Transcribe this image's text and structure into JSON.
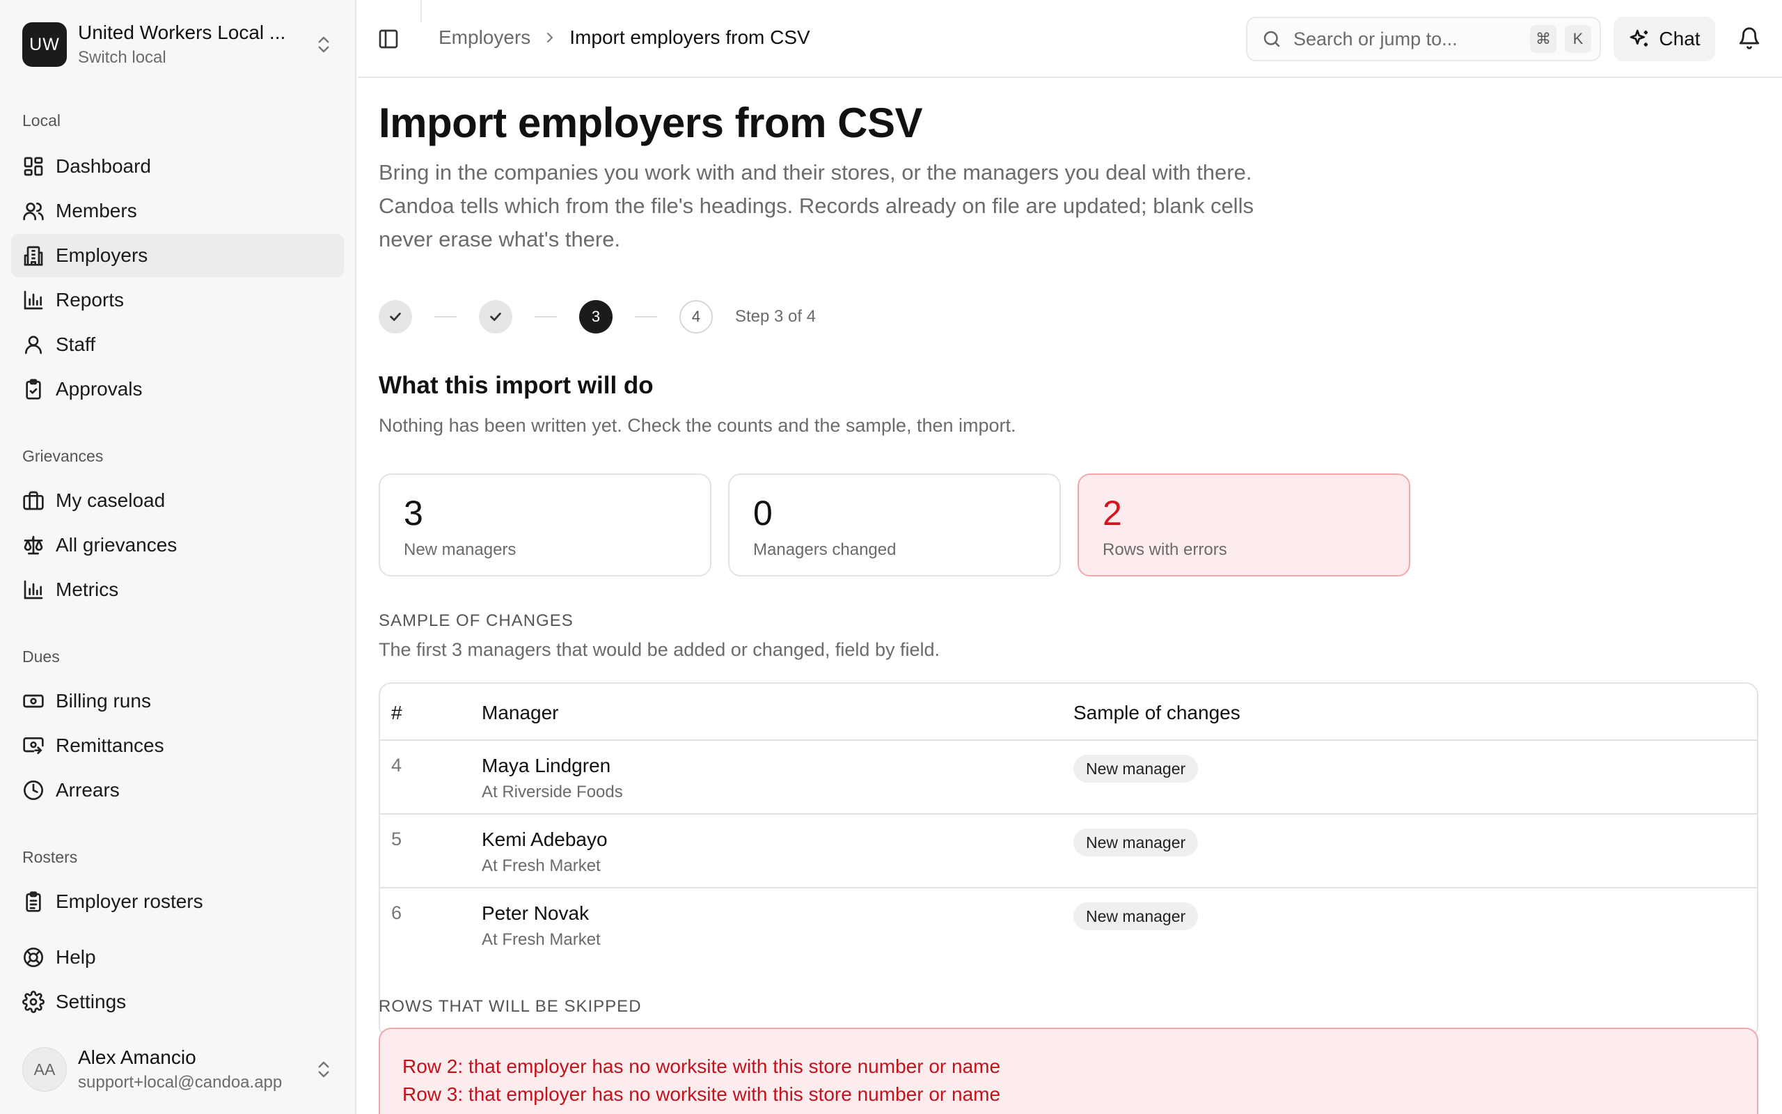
{
  "workspace": {
    "initials": "UW",
    "name": "United Workers Local ...",
    "sub": "Switch local"
  },
  "nav": {
    "local_label": "Local",
    "local_items": [
      {
        "label": "Dashboard",
        "icon": "dashboard-icon"
      },
      {
        "label": "Members",
        "icon": "users-icon"
      },
      {
        "label": "Employers",
        "icon": "building-icon"
      },
      {
        "label": "Reports",
        "icon": "chart-icon"
      },
      {
        "label": "Staff",
        "icon": "person-icon"
      },
      {
        "label": "Approvals",
        "icon": "clipboard-check-icon"
      }
    ],
    "grievances_label": "Grievances",
    "grievances_items": [
      {
        "label": "My caseload",
        "icon": "briefcase-icon"
      },
      {
        "label": "All grievances",
        "icon": "scale-icon"
      },
      {
        "label": "Metrics",
        "icon": "chart-icon"
      }
    ],
    "dues_label": "Dues",
    "dues_items": [
      {
        "label": "Billing runs",
        "icon": "banknote-icon"
      },
      {
        "label": "Remittances",
        "icon": "banknote-arrow-icon"
      },
      {
        "label": "Arrears",
        "icon": "clock-icon"
      }
    ],
    "rosters_label": "Rosters",
    "rosters_items": [
      {
        "label": "Employer rosters",
        "icon": "clipboard-list-icon"
      }
    ],
    "help": "Help",
    "settings": "Settings"
  },
  "user": {
    "initials": "AA",
    "name": "Alex Amancio",
    "email": "support+local@candoa.app"
  },
  "topbar": {
    "breadcrumb_parent": "Employers",
    "breadcrumb_current": "Import employers from CSV",
    "search_placeholder": "Search or jump to...",
    "kbd_cmd": "⌘",
    "kbd_k": "K",
    "chat_label": "Chat"
  },
  "page": {
    "title": "Import employers from CSV",
    "description": "Bring in the companies you work with and their stores, or the managers you deal with there. Candoa tells which from the file's headings. Records already on file are updated; blank cells never erase what's there.",
    "steps": {
      "current": 3,
      "total": 4,
      "step3": "3",
      "step4": "4",
      "label": "Step 3 of 4"
    },
    "section_title": "What this import will do",
    "section_sub": "Nothing has been written yet. Check the counts and the sample, then import.",
    "stats": [
      {
        "value": "3",
        "label": "New managers"
      },
      {
        "value": "0",
        "label": "Managers changed"
      },
      {
        "value": "2",
        "label": "Rows with errors"
      }
    ],
    "sample_heading": "SAMPLE OF CHANGES",
    "sample_sub": "The first 3 managers that would be added or changed, field by field.",
    "table": {
      "headers": [
        "#",
        "Manager",
        "Sample of changes"
      ],
      "rows": [
        {
          "num": "4",
          "name": "Maya Lindgren",
          "at": "At Riverside Foods",
          "change": "New manager"
        },
        {
          "num": "5",
          "name": "Kemi Adebayo",
          "at": "At Fresh Market",
          "change": "New manager"
        },
        {
          "num": "6",
          "name": "Peter Novak",
          "at": "At Fresh Market",
          "change": "New manager"
        }
      ]
    },
    "skip_heading": "ROWS THAT WILL BE SKIPPED",
    "skip_rows": [
      "Row 2: that employer has no worksite with this store number or name",
      "Row 3: that employer has no worksite with this store number or name"
    ]
  },
  "colors": {
    "accent_dark": "#1b1b1b",
    "error_text": "#d5141d",
    "error_bg": "#fdecee",
    "error_border": "#f2a7ad"
  }
}
